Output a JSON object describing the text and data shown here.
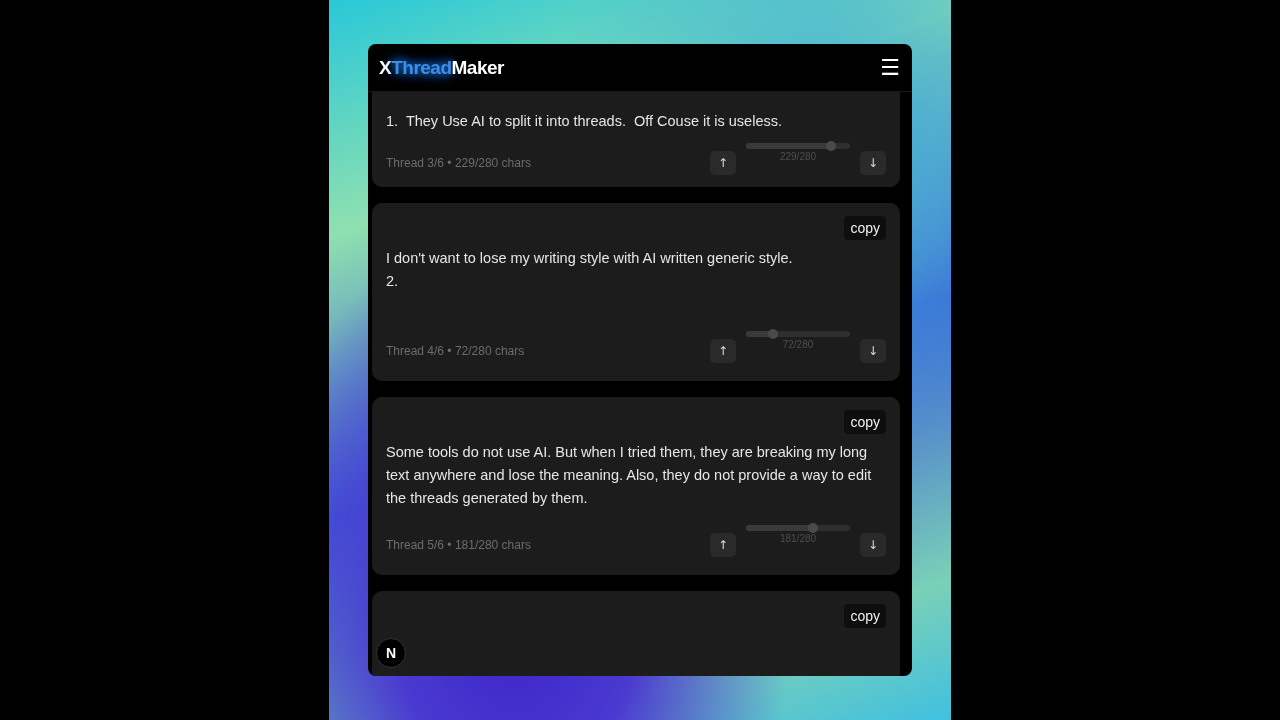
{
  "app": {
    "logo": [
      {
        "text": "X",
        "kind": "plain"
      },
      {
        "text": "Thread",
        "kind": "glow"
      },
      {
        "text": "Maker",
        "kind": "plain"
      }
    ],
    "menu_icon": "☰"
  },
  "threads": [
    {
      "text": "1.  They Use AI to split it into threads.  Off Couse it is useless.",
      "info": "Thread 3/6 • 229/280 chars",
      "up": "↑",
      "down": "↓",
      "level": 0.818,
      "reading": "229/280"
    },
    {
      "text": "I don't want to lose my writing style with AI written generic style.\n2.",
      "copy": "copy",
      "info": "Thread 4/6 • 72/280 chars",
      "up": "↑",
      "down": "↓",
      "level": 0.257,
      "reading": "72/280"
    },
    {
      "text": "Some tools do not use AI. But when I tried them, they are breaking my long text anywhere and lose the meaning. Also, they do not provide a way to edit the threads generated by them.",
      "copy": "copy",
      "info": "Thread 5/6 • 181/280 chars",
      "up": "↑",
      "down": "↓",
      "level": 0.646,
      "reading": "181/280"
    },
    {
      "copy": "copy"
    }
  ],
  "dev_badge": "N"
}
